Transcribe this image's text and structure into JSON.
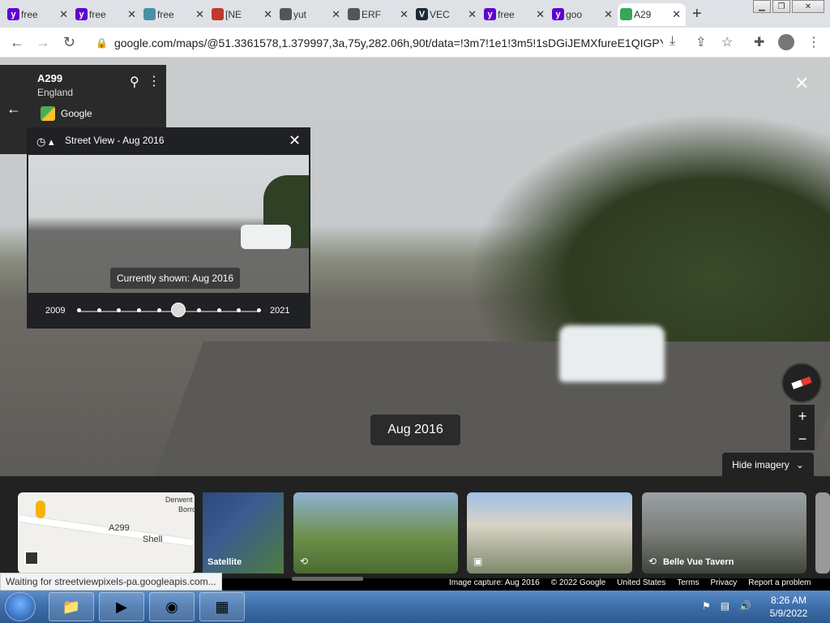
{
  "browser": {
    "tabs": [
      {
        "label": "free",
        "favicon": "yahoo-icon",
        "color": "#6001d2"
      },
      {
        "label": "free",
        "favicon": "yahoo-icon",
        "color": "#6001d2"
      },
      {
        "label": "free",
        "favicon": "search-doc-icon",
        "color": "#4a90a4"
      },
      {
        "label": "[NE",
        "favicon": "target-icon",
        "color": "#c0392b"
      },
      {
        "label": "yut",
        "favicon": "globe-icon",
        "color": "#555555"
      },
      {
        "label": "ERF",
        "favicon": "globe-icon",
        "color": "#555555"
      },
      {
        "label": "VEC",
        "favicon": "v-icon",
        "color": "#1b2a36"
      },
      {
        "label": "free",
        "favicon": "yahoo-icon",
        "color": "#6001d2"
      },
      {
        "label": "goo",
        "favicon": "yahoo-icon",
        "color": "#6001d2"
      },
      {
        "label": "A29",
        "favicon": "maps-pin-icon",
        "color": "#34a853",
        "active": true
      }
    ],
    "url": "google.com/maps/@51.3361578,1.379997,3a,75y,282.06h,90t/data=!3m7!1e1!3m5!1sDGiJEMXfureE1QIGPY..."
  },
  "location": {
    "title": "A299",
    "subtitle": "England",
    "source": "Google"
  },
  "time_machine": {
    "title": "Street View - Aug 2016",
    "tooltip": "Currently shown: Aug 2016",
    "start_year": "2009",
    "end_year": "2021",
    "ticks": 10,
    "selected_index": 5
  },
  "viewer": {
    "date_badge": "Aug 2016",
    "hide_imagery": "Hide imagery"
  },
  "strip": {
    "satellite_label": "Satellite",
    "photo3_label": "Belle Vue Tavern",
    "map_labels": [
      "A299",
      "Shell",
      "Derwent",
      "Borrowd"
    ]
  },
  "footer": {
    "items": [
      "Image capture: Aug 2016",
      "© 2022 Google",
      "United States",
      "Terms",
      "Privacy",
      "Report a problem"
    ]
  },
  "status": "Waiting for streetviewpixels-pa.googleapis.com...",
  "taskbar": {
    "time": "8:26 AM",
    "date": "5/9/2022"
  },
  "colors": {
    "accent": "#1a73e8",
    "panel": "#202124",
    "taskbar": "#3c6ea8"
  }
}
